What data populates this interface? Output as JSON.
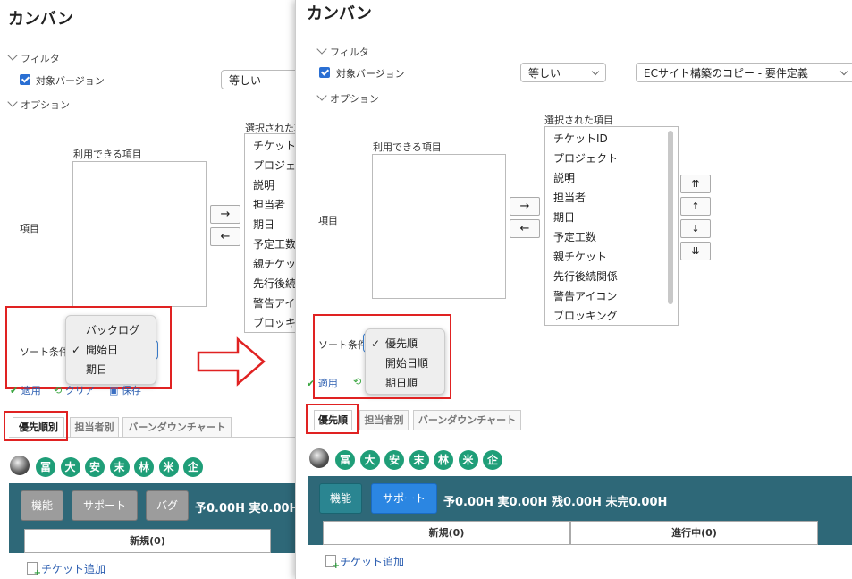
{
  "left": {
    "title": "カンバン",
    "filter_label": "フィルタ",
    "version_label": "対象バージョン",
    "operator": "等しい",
    "options_label": "オプション",
    "items_label": "項目",
    "available_label": "利用できる項目",
    "selected_label": "選択された項目",
    "selected_items": [
      "チケット",
      "プロジェ",
      "説明",
      "担当者",
      "期日",
      "予定工数",
      "親チケッ",
      "先行後続",
      "警告アイ",
      "ブロッキ"
    ],
    "arrow_right": "→",
    "arrow_left": "←",
    "sort_label": "ソート条件",
    "sort_menu": [
      {
        "label": "バックログ",
        "checked": false
      },
      {
        "label": "開始日",
        "checked": true
      },
      {
        "label": "期日",
        "checked": false
      }
    ],
    "check_mark": "✓",
    "apply": "適用",
    "clear": "クリア",
    "save": "保存",
    "tabs": [
      "優先順別",
      "担当者別",
      "バーンダウンチャート"
    ],
    "badges": [
      "冨",
      "大",
      "安",
      "末",
      "林",
      "米",
      "企"
    ],
    "buttons": [
      "機能",
      "サポート",
      "バグ"
    ],
    "stats": "予0.00H 実0.00H",
    "col_new": "新規(0)",
    "add_ticket": "チケット追加"
  },
  "right": {
    "title": "カンバン",
    "filter_label": "フィルタ",
    "version_label": "対象バージョン",
    "operator": "等しい",
    "version_value": "ECサイト構築のコピー - 要件定義",
    "options_label": "オプション",
    "items_label": "項目",
    "available_label": "利用できる項目",
    "selected_label": "選択された項目",
    "selected_items": [
      "チケットID",
      "プロジェクト",
      "説明",
      "担当者",
      "期日",
      "予定工数",
      "親チケット",
      "先行後続関係",
      "警告アイコン",
      "ブロッキング"
    ],
    "arrow_right": "→",
    "arrow_left": "←",
    "move_buttons": [
      "⇈",
      "↑",
      "↓",
      "⇊"
    ],
    "sort_label": "ソート条件",
    "sort_menu": [
      {
        "label": "優先順",
        "checked": true
      },
      {
        "label": "開始日順",
        "checked": false
      },
      {
        "label": "期日順",
        "checked": false
      }
    ],
    "check_mark": "✓",
    "apply": "適用",
    "tabs": [
      "優先順",
      "担当者別",
      "バーンダウンチャート"
    ],
    "badges": [
      "冨",
      "大",
      "安",
      "末",
      "林",
      "米",
      "企"
    ],
    "buttons": [
      "機能",
      "サポート"
    ],
    "stats": "予0.00H 実0.00H 残0.00H 未完0.00H",
    "col_new": "新規(0)",
    "col_progress": "進行中(0)",
    "add_ticket": "チケット追加"
  },
  "colors": {
    "highlight": "#e02222",
    "board": "#2e6878",
    "badge": "#1f9e78",
    "link": "#2a5db0"
  }
}
